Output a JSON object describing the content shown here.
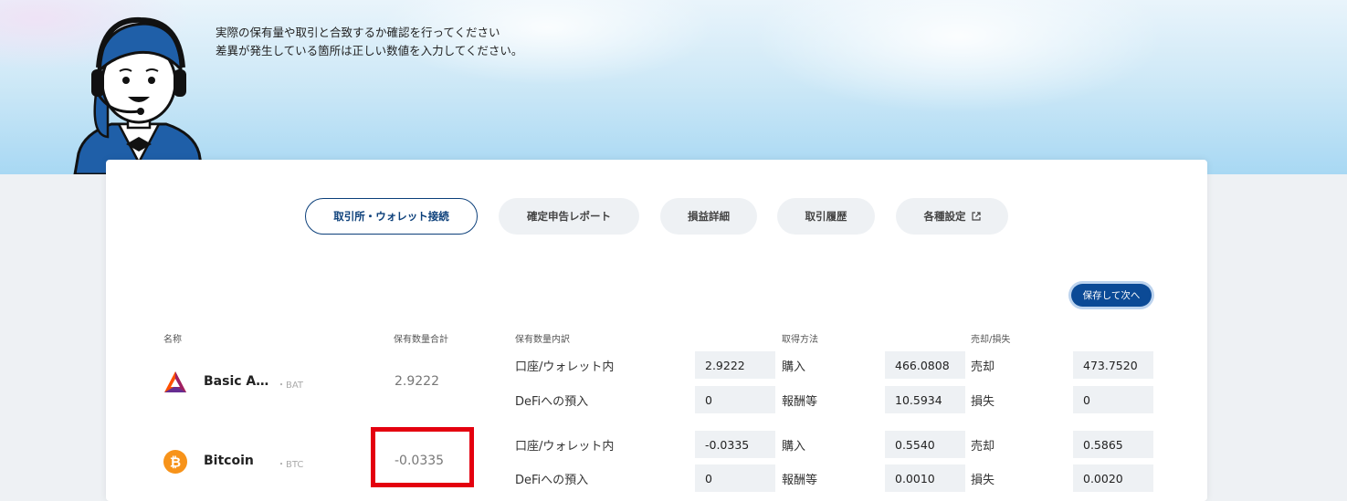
{
  "instructions": {
    "line1": "実際の保有量や取引と合致するか確認を行ってください",
    "line2": "差異が発生している箇所は正しい数値を入力してください。"
  },
  "nav": {
    "tabs": [
      {
        "label": "取引所・ウォレット接続",
        "active": true
      },
      {
        "label": "確定申告レポート"
      },
      {
        "label": "損益詳細"
      },
      {
        "label": "取引履歴"
      },
      {
        "label": "各種設定",
        "icon": "external-link-icon"
      }
    ]
  },
  "save_next_label": "保存して次へ",
  "table": {
    "headers": {
      "name": "名称",
      "total": "保有数量合計",
      "breakdown": "保有数量内訳",
      "acquisition": "取得方法",
      "sale": "売却/損失"
    },
    "rows": [
      {
        "name": "Basic A…",
        "symbol": "・BAT",
        "icon": "bat-icon",
        "total": "2.9222",
        "wallet_label": "口座/ウォレット内",
        "wallet_value": "2.9222",
        "purchase_label": "購入",
        "purchase_value": "466.0808",
        "sell_label": "売却",
        "sell_value": "473.7520",
        "defi_label": "DeFiへの預入",
        "defi_value": "0",
        "reward_label": "報酬等",
        "reward_value": "10.5934",
        "loss_label": "損失",
        "loss_value": "0"
      },
      {
        "name": "Bitcoin",
        "symbol": "・BTC",
        "icon": "bitcoin-icon",
        "total": "-0.0335",
        "wallet_label": "口座/ウォレット内",
        "wallet_value": "-0.0335",
        "purchase_label": "購入",
        "purchase_value": "0.5540",
        "sell_label": "売却",
        "sell_value": "0.5865",
        "defi_label": "DeFiへの預入",
        "defi_value": "0",
        "reward_label": "報酬等",
        "reward_value": "0.0010",
        "loss_label": "損失",
        "loss_value": "0.0020"
      }
    ]
  },
  "colors": {
    "accent": "#0b3f7a",
    "button": "#0b4a96",
    "highlight": "#e4000f",
    "bitcoin": "#f7931a"
  }
}
